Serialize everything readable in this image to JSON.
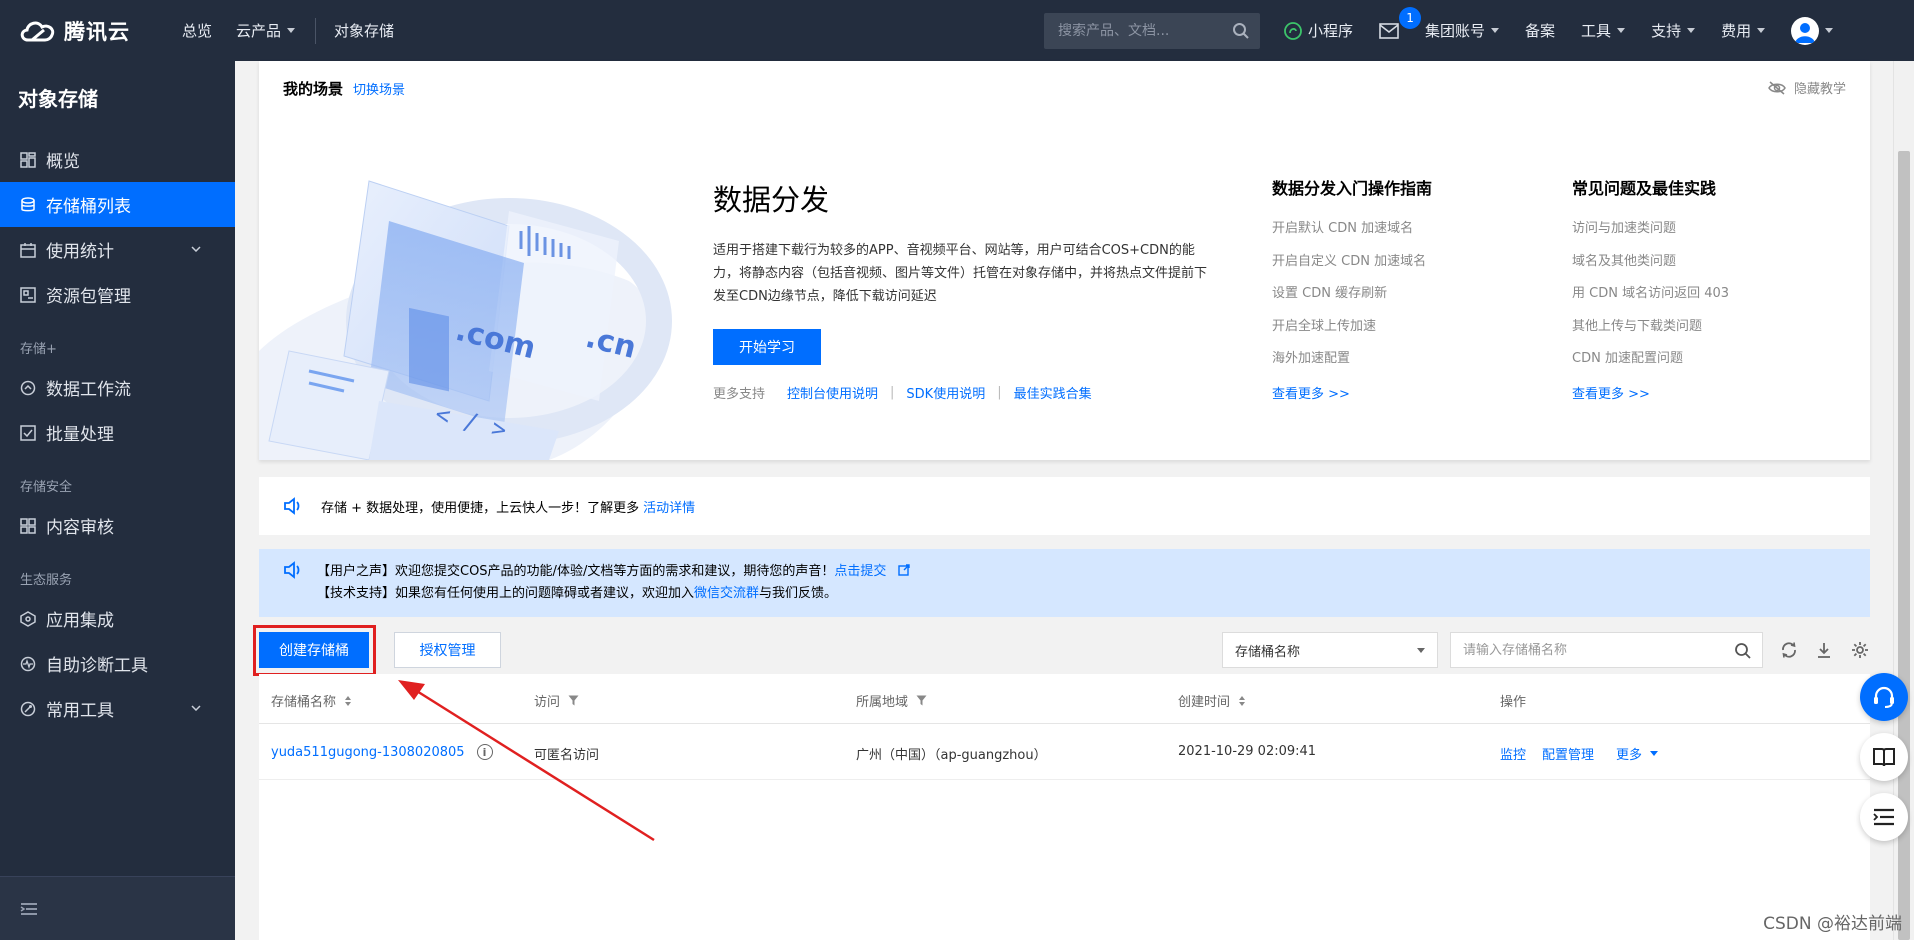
{
  "topbar": {
    "brand": "腾讯云",
    "nav": [
      {
        "label": "总览",
        "dropdown": false
      },
      {
        "label": "云产品",
        "dropdown": true
      }
    ],
    "product": "对象存储",
    "search_placeholder": "搜索产品、文档...",
    "right": [
      {
        "label": "小程序",
        "icon": "miniprogram-icon",
        "dropdown": false
      },
      {
        "label": "",
        "icon": "mail-icon",
        "badge": "1"
      },
      {
        "label": "集团账号",
        "dropdown": true
      },
      {
        "label": "备案",
        "dropdown": false
      },
      {
        "label": "工具",
        "dropdown": true
      },
      {
        "label": "支持",
        "dropdown": true
      },
      {
        "label": "费用",
        "dropdown": true
      }
    ]
  },
  "sidebar": {
    "title": "对象存储",
    "items": [
      {
        "label": "概览",
        "icon": "grid-icon"
      },
      {
        "label": "存储桶列表",
        "icon": "bucket-icon",
        "active": true
      },
      {
        "label": "使用统计",
        "icon": "calendar-icon",
        "expand": true
      },
      {
        "label": "资源包管理",
        "icon": "package-icon"
      }
    ],
    "group1": "存储+",
    "items2": [
      {
        "label": "数据工作流",
        "icon": "workflow-icon"
      },
      {
        "label": "批量处理",
        "icon": "batch-icon"
      }
    ],
    "group2": "存储安全",
    "items3": [
      {
        "label": "内容审核",
        "icon": "grid-icon"
      }
    ],
    "group3": "生态服务",
    "items4": [
      {
        "label": "应用集成",
        "icon": "integration-icon"
      },
      {
        "label": "自助诊断工具",
        "icon": "diagnose-icon"
      },
      {
        "label": "常用工具",
        "icon": "tools-icon",
        "expand": true
      }
    ]
  },
  "scene": {
    "title": "我的场景",
    "switch": "切换场景",
    "hide": "隐藏教学",
    "heading": "数据分发",
    "desc": "适用于搭建下载行为较多的APP、音视频平台、网站等，用户可结合COS+CDN的能力，将静态内容（包括音视频、图片等文件）托管在对象存储中，并将热点文件提前下发至CDN边缘节点，降低下载访问延迟",
    "start_btn": "开始学习",
    "more_label": "更多支持",
    "more_links": [
      "控制台使用说明",
      "SDK使用说明",
      "最佳实践合集"
    ],
    "col1": {
      "title": "数据分发入门操作指南",
      "items": [
        "开启默认 CDN 加速域名",
        "开启自定义 CDN 加速域名",
        "设置 CDN 缓存刷新",
        "开启全球上传加速",
        "海外加速配置"
      ],
      "more": "查看更多 >>"
    },
    "col2": {
      "title": "常见问题及最佳实践",
      "items": [
        "访问与加速类问题",
        "域名及其他类问题",
        "用 CDN 域名访问返回 403",
        "其他上传与下载类问题",
        "CDN 加速配置问题"
      ],
      "more": "查看更多 >>"
    },
    "illus_text": [
      ".com",
      ".cn",
      "< / >"
    ]
  },
  "notice1": {
    "text": "存储 + 数据处理，使用便捷，上云快人一步！了解更多",
    "link": "活动详情"
  },
  "notice2": {
    "line1": "【用户之声】欢迎您提交COS产品的功能/体验/文档等方面的需求和建议，期待您的声音！",
    "line1_link": "点击提交",
    "line2_a": "【技术支持】如果您有任何使用上的问题障碍或者建议，欢迎加入",
    "line2_link": "微信交流群",
    "line2_b": "与我们反馈。"
  },
  "toolbar": {
    "create": "创建存储桶",
    "auth": "授权管理",
    "select_value": "存储桶名称",
    "search_placeholder": "请输入存储桶名称"
  },
  "table": {
    "columns": [
      "存储桶名称",
      "访问",
      "所属地域",
      "创建时间",
      "操作"
    ],
    "rows": [
      {
        "name": "yuda511gugong-1308020805",
        "access": "可匿名访问",
        "region": "广州（中国）（ap-guangzhou）",
        "created": "2021-10-29 02:09:41",
        "actions": [
          "监控",
          "配置管理",
          "更多"
        ]
      }
    ]
  },
  "watermark": "CSDN @裕达前端",
  "colors": {
    "nav_bg": "#232d3e",
    "primary": "#006eff",
    "highlight": "#e02020",
    "notice_bg": "#d5e7ff"
  }
}
